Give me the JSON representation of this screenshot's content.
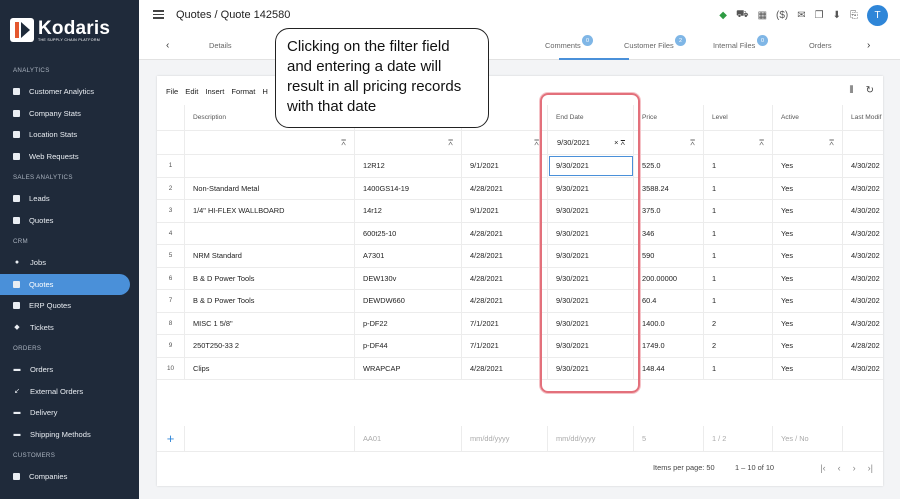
{
  "brand": {
    "name": "Kodaris",
    "tagline": "THE SUPPLY CHAIN PLATFORM"
  },
  "sidebar": {
    "sections": [
      {
        "title": "ANALYTICS",
        "items": [
          {
            "label": "Customer Analytics",
            "icon": "chart-icon"
          },
          {
            "label": "Company Stats",
            "icon": "chart-icon"
          },
          {
            "label": "Location Stats",
            "icon": "chart-icon"
          },
          {
            "label": "Web Requests",
            "icon": "chart-icon"
          }
        ]
      },
      {
        "title": "SALES ANALYTICS",
        "items": [
          {
            "label": "Leads",
            "icon": "chart-icon"
          },
          {
            "label": "Quotes",
            "icon": "chart-icon"
          }
        ]
      },
      {
        "title": "CRM",
        "items": [
          {
            "label": "Jobs",
            "icon": "pin-icon"
          },
          {
            "label": "Quotes",
            "icon": "quote-icon",
            "active": true
          },
          {
            "label": "ERP Quotes",
            "icon": "quote-icon"
          },
          {
            "label": "Tickets",
            "icon": "ticket-icon"
          }
        ]
      },
      {
        "title": "ORDERS",
        "items": [
          {
            "label": "Orders",
            "icon": "truck-icon"
          },
          {
            "label": "External Orders",
            "icon": "arrow-icon"
          },
          {
            "label": "Delivery",
            "icon": "truck-icon"
          },
          {
            "label": "Shipping Methods",
            "icon": "truck-icon"
          }
        ]
      },
      {
        "title": "CUSTOMERS",
        "items": [
          {
            "label": "Companies",
            "icon": "building-icon"
          }
        ]
      }
    ]
  },
  "header": {
    "breadcrumb": "Quotes / Quote 142580",
    "avatar": "T",
    "dollar_icon": "($)"
  },
  "tabs": [
    {
      "label": "Details"
    },
    {
      "label": "Comments",
      "badge": "0"
    },
    {
      "label": "Customer Files",
      "badge": "2"
    },
    {
      "label": "Internal Files",
      "badge": "0"
    },
    {
      "label": "Orders"
    }
  ],
  "toolbar": {
    "file": "File",
    "edit": "Edit",
    "insert": "Insert",
    "format": "Format",
    "help": "H"
  },
  "grid": {
    "columns": [
      "Description",
      "",
      "",
      "End Date",
      "Price",
      "Level",
      "Active",
      "Last Modif"
    ],
    "end_date_filter": "9/30/2021",
    "rows": [
      {
        "n": "1",
        "desc": "",
        "item": "12R12",
        "start": "9/1/2021",
        "end": "9/30/2021",
        "price": "525.0",
        "level": "1",
        "active": "Yes",
        "mod": "4/30/202"
      },
      {
        "n": "2",
        "desc": "Non-Standard Metal",
        "item": "1400GS14-19",
        "start": "4/28/2021",
        "end": "9/30/2021",
        "price": "3588.24",
        "level": "1",
        "active": "Yes",
        "mod": "4/30/202"
      },
      {
        "n": "3",
        "desc": "1/4\" HI-FLEX WALLBOARD",
        "item": "14r12",
        "start": "9/1/2021",
        "end": "9/30/2021",
        "price": "375.0",
        "level": "1",
        "active": "Yes",
        "mod": "4/30/202"
      },
      {
        "n": "4",
        "desc": "",
        "item": "600t25-10",
        "start": "4/28/2021",
        "end": "9/30/2021",
        "price": "346",
        "level": "1",
        "active": "Yes",
        "mod": "4/30/202"
      },
      {
        "n": "5",
        "desc": "NRM Standard",
        "item": "A7301",
        "start": "4/28/2021",
        "end": "9/30/2021",
        "price": "590",
        "level": "1",
        "active": "Yes",
        "mod": "4/30/202"
      },
      {
        "n": "6",
        "desc": "B & D Power Tools",
        "item": "DEW130v",
        "start": "4/28/2021",
        "end": "9/30/2021",
        "price": "200.00000",
        "level": "1",
        "active": "Yes",
        "mod": "4/30/202"
      },
      {
        "n": "7",
        "desc": "B & D Power Tools",
        "item": "DEWDW660",
        "start": "4/28/2021",
        "end": "9/30/2021",
        "price": "60.4",
        "level": "1",
        "active": "Yes",
        "mod": "4/30/202"
      },
      {
        "n": "8",
        "desc": "MISC 1 5/8\"",
        "item": "p-DF22",
        "start": "7/1/2021",
        "end": "9/30/2021",
        "price": "1400.0",
        "level": "2",
        "active": "Yes",
        "mod": "4/30/202"
      },
      {
        "n": "9",
        "desc": "250T250-33 2",
        "item": "p-DF44",
        "start": "7/1/2021",
        "end": "9/30/2021",
        "price": "1749.0",
        "level": "2",
        "active": "Yes",
        "mod": "4/28/202"
      },
      {
        "n": "10",
        "desc": "Clips",
        "item": "WRAPCAP",
        "start": "4/28/2021",
        "end": "9/30/2021",
        "price": "148.44",
        "level": "1",
        "active": "Yes",
        "mod": "4/30/202"
      }
    ],
    "new_row": {
      "item": "AA01",
      "start": "mm/dd/yyyy",
      "end": "mm/dd/yyyy",
      "price": "5",
      "level": "1 / 2",
      "active": "Yes / No"
    },
    "footer": {
      "items_per_page": "Items per page: 50",
      "range": "1 – 10 of 10"
    }
  },
  "callout": {
    "text": "Clicking on the filter field and entering a date will result in all pricing records with that date"
  }
}
